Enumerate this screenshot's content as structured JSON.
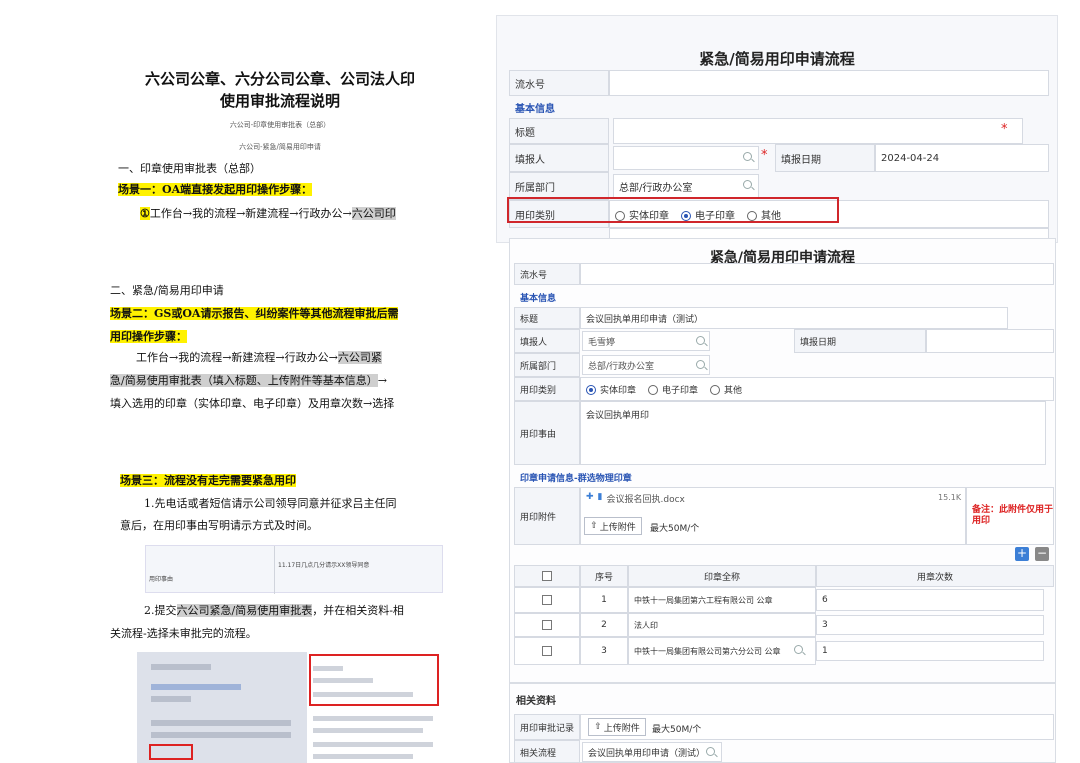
{
  "doc": {
    "title_line1": "六公司公章、六分公司公章、公司法人印",
    "title_line2": "使用审批流程说明",
    "sub1": "六公司-印章使用审批表（总部）",
    "sub2": "六公司-紧急/简易用印申请",
    "s1_heading": "一、印章使用审批表（总部）",
    "s1_scene": "场景一：OA端直接发起用印操作步骤：",
    "s1_step_num": "①",
    "s1_step_text": "工作台→我的流程→新建流程→行政办公→",
    "s1_step_tail": "六公司印",
    "s2_heading": "二、紧急/简易用印申请",
    "s2_scene_a": "场景二：GS或OA请示报告、纠纷案件等其他流程审批后需",
    "s2_scene_b": "用印操作步骤：",
    "s2_p1_a": "工作台→我的流程→新建流程→行政办公→",
    "s2_p1_b": "六公司紧",
    "s2_p2_a": "急/简易使用审批表（填入标题、上传附件等基本信息）",
    "s2_p2_b": "→",
    "s2_p3": "填入选用的印章（实体印章、电子印章）及用章次数→选择",
    "s3_scene": "场景三：流程没有走完需要紧急用印",
    "s3_p1_a": "1.先电话或者短信请示公司领导同意并征求吕主任同",
    "s3_p1_b": "意后，在用印事由写明请示方式及时间。",
    "thumb1_label": "用印事由",
    "thumb1_value": "11.17日几点几分请示XX领导同意",
    "s3_p2_a": "2.提交",
    "s3_p2_b": "六公司紧急/简易使用审批表",
    "s3_p2_c": "，并在相关资料-相",
    "s3_p2_d": "关流程-选择未审批完的流程。"
  },
  "formA": {
    "title": "紧急/简易用印申请流程",
    "serial_label": "流水号",
    "basic_info": "基本信息",
    "title_label": "标题",
    "applicant_label": "填报人",
    "date_label": "填报日期",
    "date_value": "2024-04-24",
    "dept_label": "所属部门",
    "dept_value": "总部/行政办公室",
    "seal_type_label": "用印类别",
    "seal_options": [
      "实体印章",
      "电子印章",
      "其他"
    ],
    "required_mark": "*"
  },
  "formB": {
    "title": "紧急/简易用印申请流程",
    "serial_label": "流水号",
    "basic_info": "基本信息",
    "title_label": "标题",
    "title_value": "会议回执单用印申请（测试）",
    "applicant_label": "填报人",
    "applicant_value": "毛雪婷",
    "date_label": "填报日期",
    "dept_label": "所属部门",
    "dept_value": "总部/行政办公室",
    "seal_type_label": "用印类别",
    "seal_options": [
      "实体印章",
      "电子印章",
      "其他"
    ],
    "reason_label": "用印事由",
    "reason_value": "会议回执单用印",
    "seal_section": "印章申请信息-群选物理印章",
    "attach_label": "用印附件",
    "attach_file": "会议报名回执.docx",
    "attach_size": "15.1K",
    "upload_button": "上传附件",
    "max_size": "最大50M/个",
    "note": "备注：此附件仅用于用印",
    "table_headers": [
      "序号",
      "印章全称",
      "用章次数"
    ],
    "rows": [
      {
        "no": "1",
        "name": "中铁十一局集团第六工程有限公司 公章",
        "count": "6"
      },
      {
        "no": "2",
        "name": "法人印",
        "count": "3"
      },
      {
        "no": "3",
        "name": "中铁十一局集团有限公司第六分公司 公章",
        "count": "1"
      }
    ]
  },
  "formC": {
    "section": "相关资料",
    "record_label": "用印审批记录",
    "upload_button": "上传附件",
    "max_size": "最大50M/个",
    "flow_label": "相关流程",
    "flow_value": "会议回执单用印申请（测试）"
  },
  "colors": {
    "highlight_yellow": "#fff200",
    "highlight_gray": "#cfcfcf",
    "section_blue": "#2a55b4",
    "red_frame": "#d0262b"
  }
}
